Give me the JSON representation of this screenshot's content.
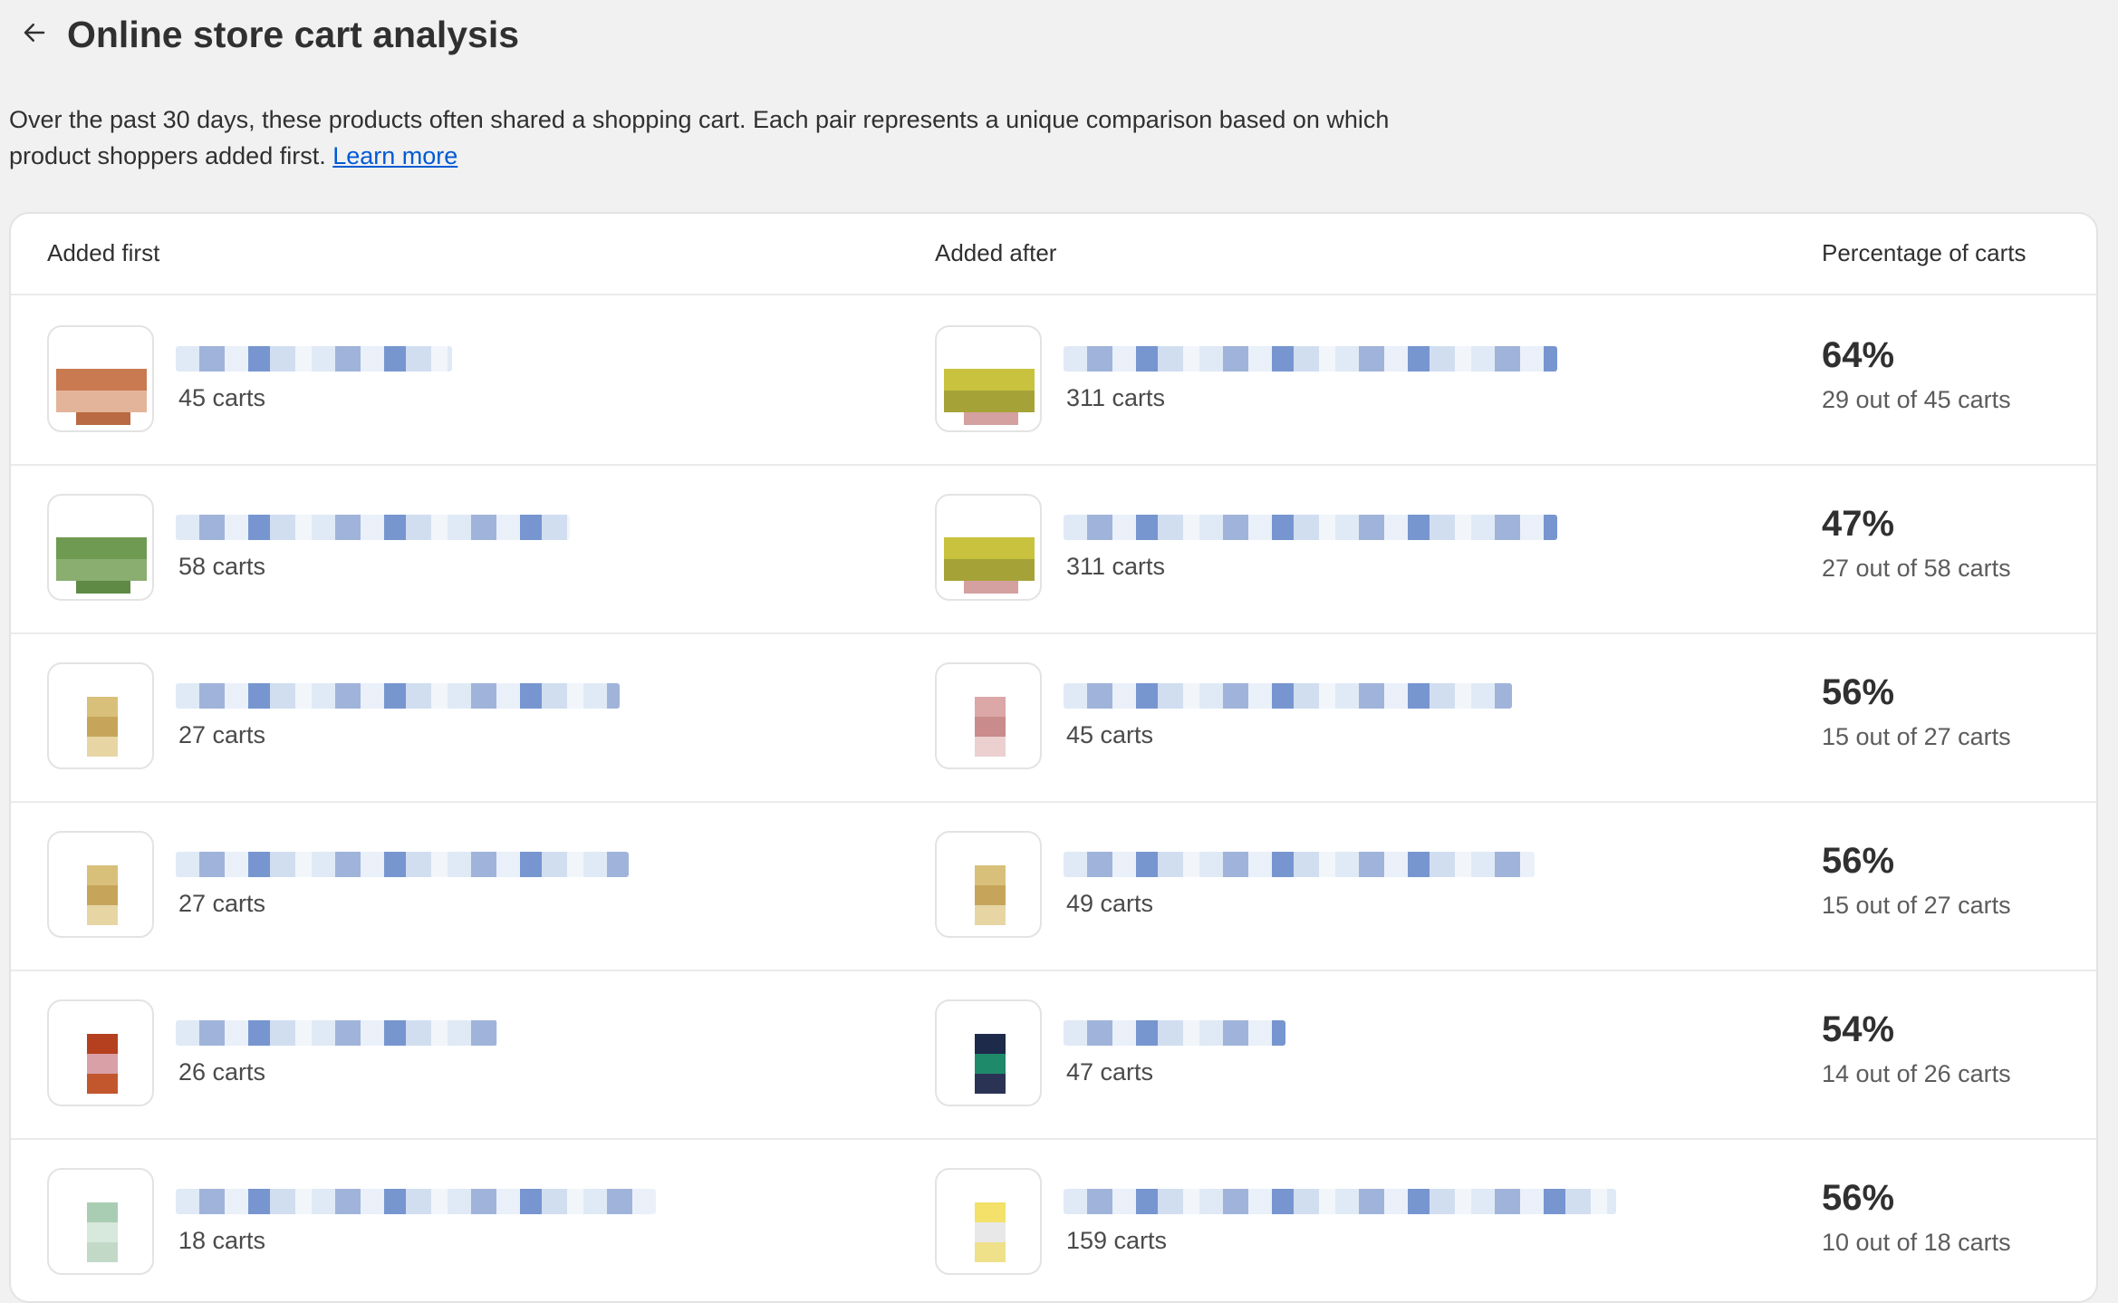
{
  "page": {
    "title": "Online store cart analysis",
    "description": "Over the past 30 days, these products often shared a shopping cart. Each pair represents a unique comparison based on which product shoppers added first.",
    "learn_more": "Learn more"
  },
  "table": {
    "headers": {
      "added_first": "Added first",
      "added_after": "Added after",
      "percentage": "Percentage of carts"
    },
    "rows": [
      {
        "first": {
          "carts": "45 carts",
          "colors": [
            "#c97a50",
            "#e3b49a",
            "#b96a42"
          ]
        },
        "after": {
          "carts": "311 carts",
          "colors": [
            "#c8c23e",
            "#a5a338",
            "#d4a0a0"
          ]
        },
        "percent": "64%",
        "ratio": "29 out of 45 carts"
      },
      {
        "first": {
          "carts": "58 carts",
          "colors": [
            "#6e9a52",
            "#8aad70",
            "#5f8a45"
          ]
        },
        "after": {
          "carts": "311 carts",
          "colors": [
            "#c8c23e",
            "#a5a338",
            "#d4a0a0"
          ]
        },
        "percent": "47%",
        "ratio": "27 out of 58 carts"
      },
      {
        "first": {
          "carts": "27 carts",
          "colors": [
            "#d9c07a",
            "#c6a55a",
            "#e7d6a4"
          ]
        },
        "after": {
          "carts": "45 carts",
          "colors": [
            "#dba7a7",
            "#c98b8b",
            "#ecd0d0"
          ]
        },
        "percent": "56%",
        "ratio": "15 out of 27 carts"
      },
      {
        "first": {
          "carts": "27 carts",
          "colors": [
            "#d9c07a",
            "#c6a55a",
            "#e7d6a4"
          ]
        },
        "after": {
          "carts": "49 carts",
          "colors": [
            "#d9c07a",
            "#c6a55a",
            "#e7d6a4"
          ]
        },
        "percent": "56%",
        "ratio": "15 out of 27 carts"
      },
      {
        "first": {
          "carts": "26 carts",
          "colors": [
            "#b5401f",
            "#d9a0a8",
            "#c2572e"
          ]
        },
        "after": {
          "carts": "47 carts",
          "colors": [
            "#1e2a4a",
            "#1f8a6a",
            "#2b3355"
          ]
        },
        "percent": "54%",
        "ratio": "14 out of 26 carts"
      },
      {
        "first": {
          "carts": "18 carts",
          "colors": [
            "#a9cdb3",
            "#d7e8dc",
            "#c2d9c8"
          ]
        },
        "after": {
          "carts": "159 carts",
          "colors": [
            "#f3e16a",
            "#e8e8e8",
            "#efe08a"
          ]
        },
        "percent": "56%",
        "ratio": "10 out of 18 carts"
      }
    ]
  }
}
